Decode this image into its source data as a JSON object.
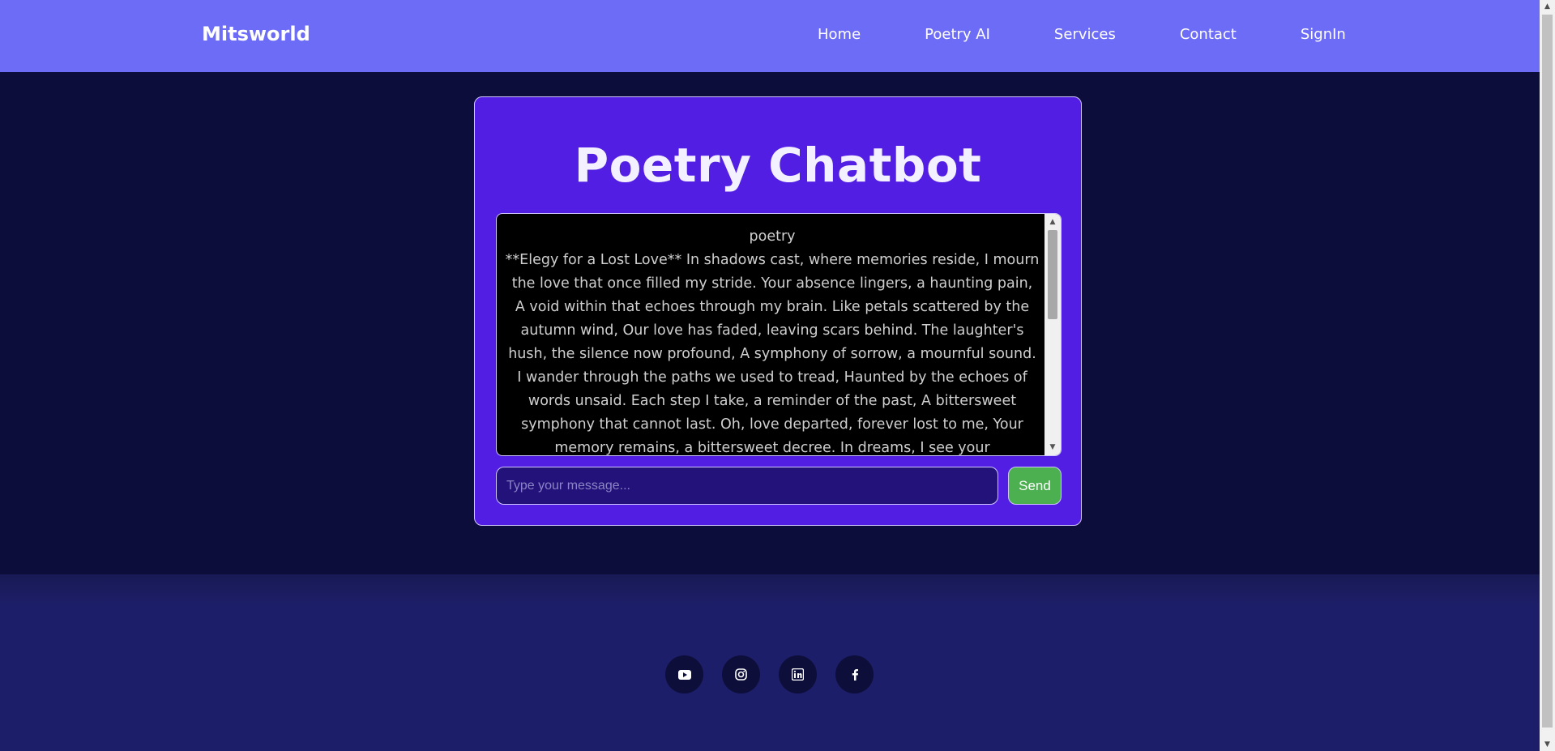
{
  "navbar": {
    "brand": "Mitsworld",
    "links": [
      "Home",
      "Poetry AI",
      "Services",
      "Contact",
      "SignIn"
    ]
  },
  "chat": {
    "title": "Poetry Chatbot",
    "message_label": "poetry",
    "message_text": "**Elegy for a Lost Love** In shadows cast, where memories reside, I mourn the love that once filled my stride. Your absence lingers, a haunting pain, A void within that echoes through my brain. Like petals scattered by the autumn wind, Our love has faded, leaving scars behind. The laughter's hush, the silence now profound, A symphony of sorrow, a mournful sound. I wander through the paths we used to tread, Haunted by the echoes of words unsaid. Each step I take, a reminder of the past, A bittersweet symphony that cannot last. Oh, love departed, forever lost to me, Your memory remains, a bittersweet decree. In dreams, I see your",
    "input_placeholder": "Type your message...",
    "input_value": "",
    "send_label": "Send"
  },
  "footer": {
    "socials": [
      "youtube-icon",
      "instagram-icon",
      "linkedin-icon",
      "facebook-icon"
    ]
  },
  "colors": {
    "navbar": "#6d6cf7",
    "page_bg": "#0c0d3a",
    "card": "#521ee3",
    "send": "#4caf50",
    "footer": "#1d1e69"
  }
}
